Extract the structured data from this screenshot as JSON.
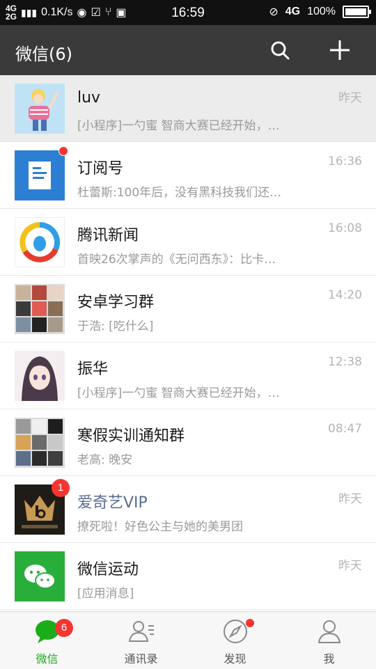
{
  "status_bar": {
    "net_top": "4G",
    "net_bottom": "2G",
    "speed": "0.1K/s",
    "time": "16:59",
    "net_right": "4G",
    "battery": "100%",
    "battery_level": 1.0
  },
  "header": {
    "title": "微信(6)",
    "search_icon": "search-icon",
    "add_icon": "plus-icon"
  },
  "chats": [
    {
      "name": "luv",
      "preview": "[小程序]一勺蜜 智商大赛已经开始，…",
      "time": "昨天"
    },
    {
      "name": "订阅号",
      "preview": "杜蕾斯:100年后，没有黑科技我们还…",
      "time": "16:36"
    },
    {
      "name": "腾讯新闻",
      "preview": "首映26次掌声的《无问西东》：比卡…",
      "time": "16:08"
    },
    {
      "name": "安卓学习群",
      "preview": "于浩: [吃什么]",
      "time": "14:20"
    },
    {
      "name": "振华",
      "preview": "[小程序]一勺蜜 智商大赛已经开始，…",
      "time": "12:38"
    },
    {
      "name": "寒假实训通知群",
      "preview": "老高: 晚安",
      "time": "08:47"
    },
    {
      "name": "爱奇艺VIP",
      "preview": "撩死啦！好色公主与她的美男团",
      "time": "昨天",
      "badge": "1"
    },
    {
      "name": "微信运动",
      "preview": "[应用消息]",
      "time": "昨天"
    }
  ],
  "tabs": [
    {
      "label": "微信",
      "badge": "6",
      "icon": "chat-bubble-icon"
    },
    {
      "label": "通讯录",
      "icon": "contacts-icon"
    },
    {
      "label": "发现",
      "icon": "compass-icon"
    },
    {
      "label": "我",
      "icon": "person-icon"
    }
  ],
  "colors": {
    "accent_green": "#1aad19",
    "badge_red": "#f43530",
    "header_bg": "#3a3a3a"
  }
}
